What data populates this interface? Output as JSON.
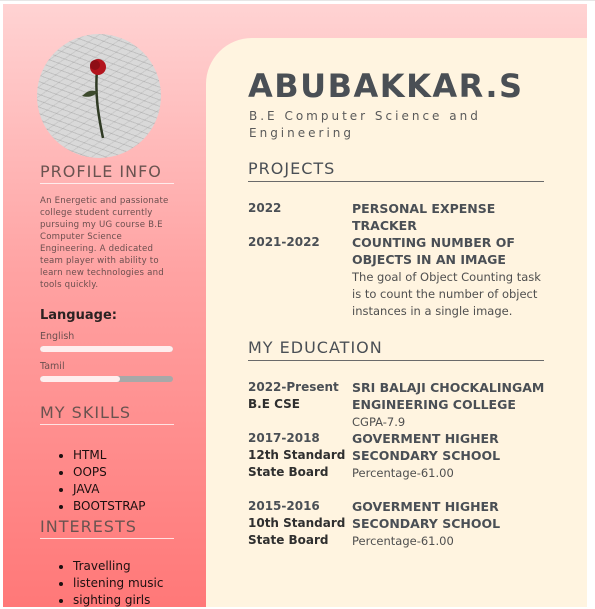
{
  "name": "ABUBAKKAR.S",
  "subtitle": "B.E Computer Science and Engineering",
  "sidebar": {
    "profile_title": "PROFILE INFO",
    "profile_text": "An Energetic and passionate college student currently pursuing my UG course B.E Computer Science Engineering. A dedicated team player with ability to learn new technologies and tools quickly.",
    "language_title": "Language:",
    "languages": [
      {
        "label": "English",
        "level": 1.0
      },
      {
        "label": "Tamil",
        "level": 0.6
      }
    ],
    "skills_title": "MY SKILLS",
    "skills": [
      "HTML",
      "OOPS",
      "JAVA",
      "BOOTSTRAP"
    ],
    "interests_title": "INTERESTS",
    "interests": [
      "Travelling",
      "listening music",
      "sighting girls"
    ]
  },
  "projects": {
    "title": "PROJECTS",
    "items": [
      {
        "year": "2022",
        "title": "PERSONAL EXPENSE TRACKER",
        "desc": ""
      },
      {
        "year": "2021-2022",
        "title": "COUNTING NUMBER OF OBJECTS IN AN IMAGE",
        "desc": "The goal of Object Counting task is to count the number of object instances in a single image."
      }
    ]
  },
  "education": {
    "title": "MY EDUCATION",
    "items": [
      {
        "year": "2022-Present",
        "course": "B.E CSE",
        "institution": "SRI BALAJI CHOCKALINGAM ENGINEERING COLLEGE",
        "score": "CGPA-7.9"
      },
      {
        "year": "2017-2018",
        "course": "12th Standard State Board",
        "institution": "GOVERMENT HIGHER SECONDARY SCHOOL",
        "score": "Percentage-61.00"
      },
      {
        "year": "2015-2016",
        "course": "10th Standard State Board",
        "institution": "GOVERMENT HIGHER SECONDARY SCHOOL",
        "score": "Percentage-61.00"
      }
    ]
  },
  "colors": {
    "sidebar_gradient_top": "#ffd3d3",
    "sidebar_gradient_bottom": "#ff7878",
    "main_background": "#fff4e0",
    "heading_text": "#4a4f55"
  }
}
